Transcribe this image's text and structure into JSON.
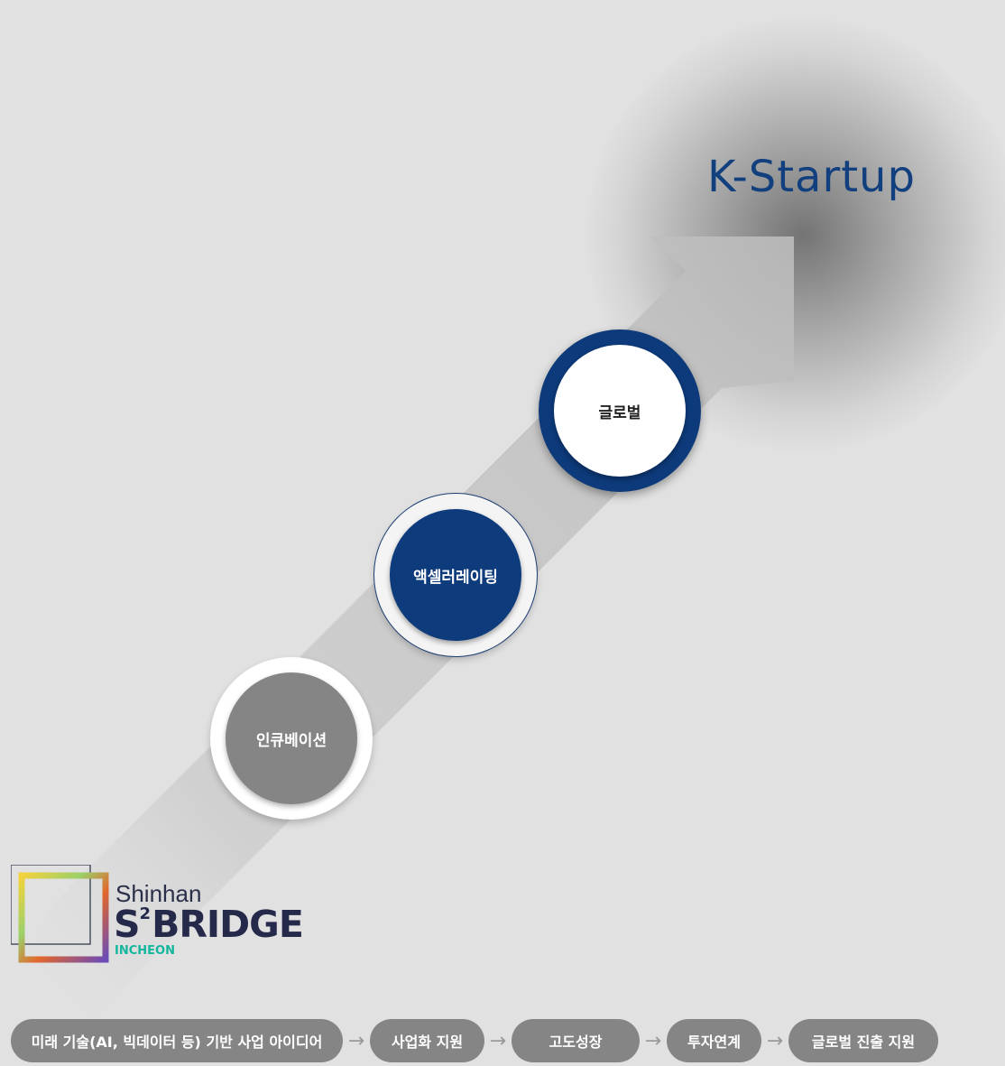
{
  "title": "K-Startup",
  "stages": [
    {
      "label": "인큐베이션"
    },
    {
      "label": "액셀러레이팅"
    },
    {
      "label": "글로벌"
    }
  ],
  "logo": {
    "line1": "Shinhan",
    "line2_main": "BRIDGE",
    "line2_prefix": "S",
    "line2_sup": "2",
    "line3": "INCHEON"
  },
  "process": [
    "미래 기술(AI, 빅데이터 등) 기반 사업 아이디어",
    "사업화 지원",
    "고도성장",
    "투자연계",
    "글로벌 진출 지원"
  ],
  "arrow_glyph": "→",
  "colors": {
    "navy": "#0e3b7c",
    "gray": "#858585",
    "title": "#123f7e",
    "teal": "#14b79e"
  }
}
